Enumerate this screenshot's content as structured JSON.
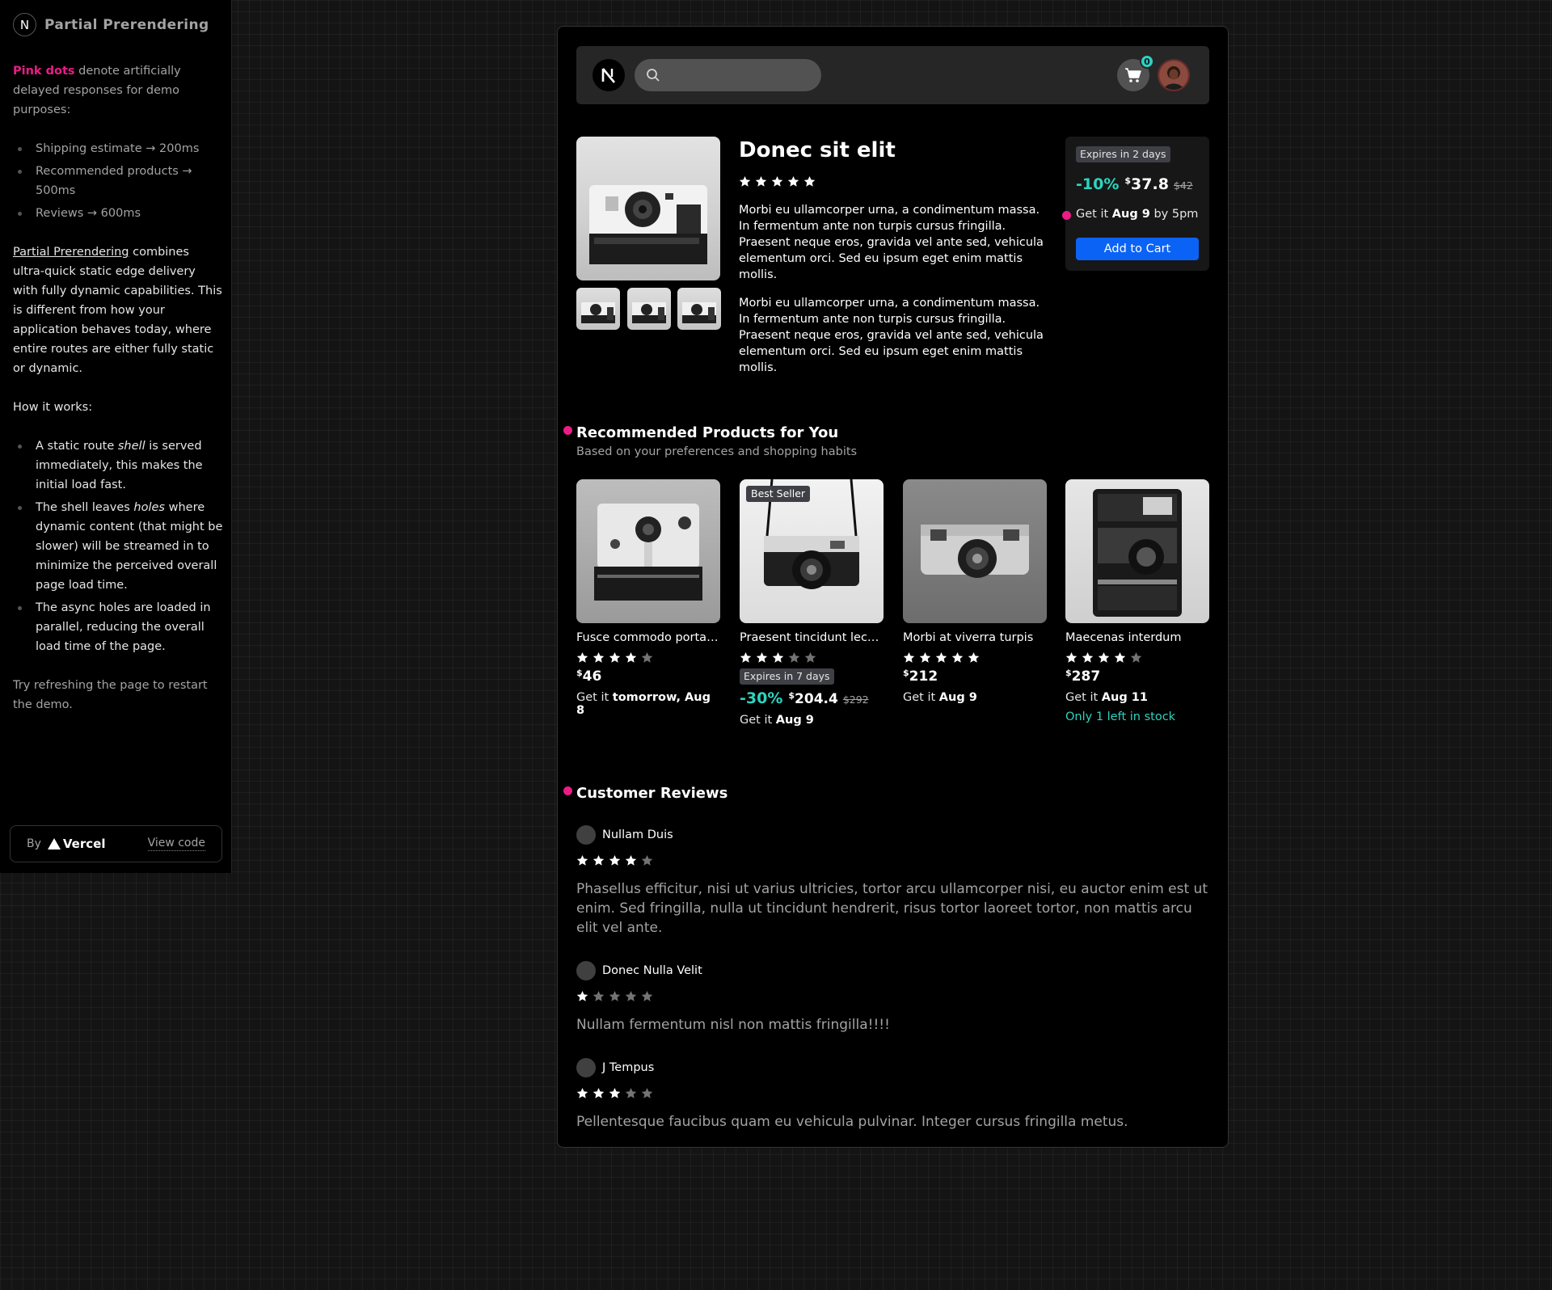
{
  "sidebar": {
    "title": "Partial Prerendering",
    "intro_highlight": "Pink dots",
    "intro_rest": " denote artificially delayed responses for demo purposes:",
    "delays": [
      "Shipping estimate → 200ms",
      "Recommended products → 500ms",
      "Reviews → 600ms"
    ],
    "ppr_link": "Partial Prerendering",
    "ppr_rest": " combines ultra-quick static edge delivery with fully dynamic capabilities. This is different from how your application behaves today, where entire routes are either fully static or dynamic.",
    "how_label": "How it works:",
    "how_items": [
      {
        "a": "A static route ",
        "em": "shell",
        "b": " is served immediately, this makes the initial load fast."
      },
      {
        "a": "The shell leaves ",
        "em": "holes",
        "b": " where dynamic content (that might be slower) will be streamed in to minimize the perceived overall page load time."
      },
      {
        "a": "The async holes are loaded in parallel, reducing the overall load time of the page.",
        "em": "",
        "b": ""
      }
    ],
    "refresh_note": "Try refreshing the page to restart the demo.",
    "footer": {
      "by": "By",
      "brand": "Vercel",
      "view_code": "View code"
    }
  },
  "header": {
    "logo_letter": "N",
    "search_placeholder": "",
    "cart_count": "0"
  },
  "product": {
    "title": "Donec sit elit",
    "rating": 5,
    "description": [
      "Morbi eu ullamcorper urna, a condimentum massa. In fermentum ante non turpis cursus fringilla. Praesent neque eros, gravida vel ante sed, vehicula elementum orci. Sed eu ipsum eget enim mattis mollis.",
      "Morbi eu ullamcorper urna, a condimentum massa. In fermentum ante non turpis cursus fringilla. Praesent neque eros, gravida vel ante sed, vehicula elementum orci. Sed eu ipsum eget enim mattis mollis."
    ],
    "buybox": {
      "expires": "Expires in 2 days",
      "discount": "-10%",
      "currency": "$",
      "price": "37.8",
      "was": "$42",
      "ship_prefix": "Get it ",
      "ship_date": "Aug 9",
      "ship_suffix": " by 5pm",
      "add_to_cart": "Add to Cart"
    }
  },
  "recommended": {
    "title": "Recommended Products for You",
    "subtitle": "Based on your preferences and shopping habits",
    "items": [
      {
        "name": "Fusce commodo porta …",
        "rating": 4,
        "currency": "$",
        "price": "46",
        "ship_prefix": "Get it ",
        "ship_date": "tomorrow, Aug 8"
      },
      {
        "name": "Praesent tincidunt lectus",
        "rating": 3,
        "badge": "Best Seller",
        "expires": "Expires in 7 days",
        "discount": "-30%",
        "currency": "$",
        "price": "204.4",
        "was": "$292",
        "ship_prefix": "Get it ",
        "ship_date": "Aug 9"
      },
      {
        "name": "Morbi at viverra turpis",
        "rating": 5,
        "currency": "$",
        "price": "212",
        "ship_prefix": "Get it ",
        "ship_date": "Aug 9"
      },
      {
        "name": "Maecenas interdum",
        "rating": 4,
        "currency": "$",
        "price": "287",
        "ship_prefix": "Get it ",
        "ship_date": "Aug 11",
        "stock": "Only 1 left in stock"
      }
    ]
  },
  "reviews": {
    "title": "Customer Reviews",
    "items": [
      {
        "name": "Nullam Duis",
        "rating": 4,
        "text": "Phasellus efficitur, nisi ut varius ultricies, tortor arcu ullamcorper nisi, eu auctor enim est ut enim. Sed fringilla, nulla ut tincidunt hendrerit, risus tortor laoreet tortor, non mattis arcu elit vel ante."
      },
      {
        "name": "Donec Nulla Velit",
        "rating": 1,
        "text": "Nullam fermentum nisl non mattis fringilla!!!!"
      },
      {
        "name": "J Tempus",
        "rating": 3,
        "text": "Pellentesque faucibus quam eu vehicula pulvinar. Integer cursus fringilla metus."
      }
    ]
  },
  "colors": {
    "accent_pink": "#ec1c85",
    "accent_teal": "#2dd4bf",
    "button_blue": "#0b63f6"
  }
}
